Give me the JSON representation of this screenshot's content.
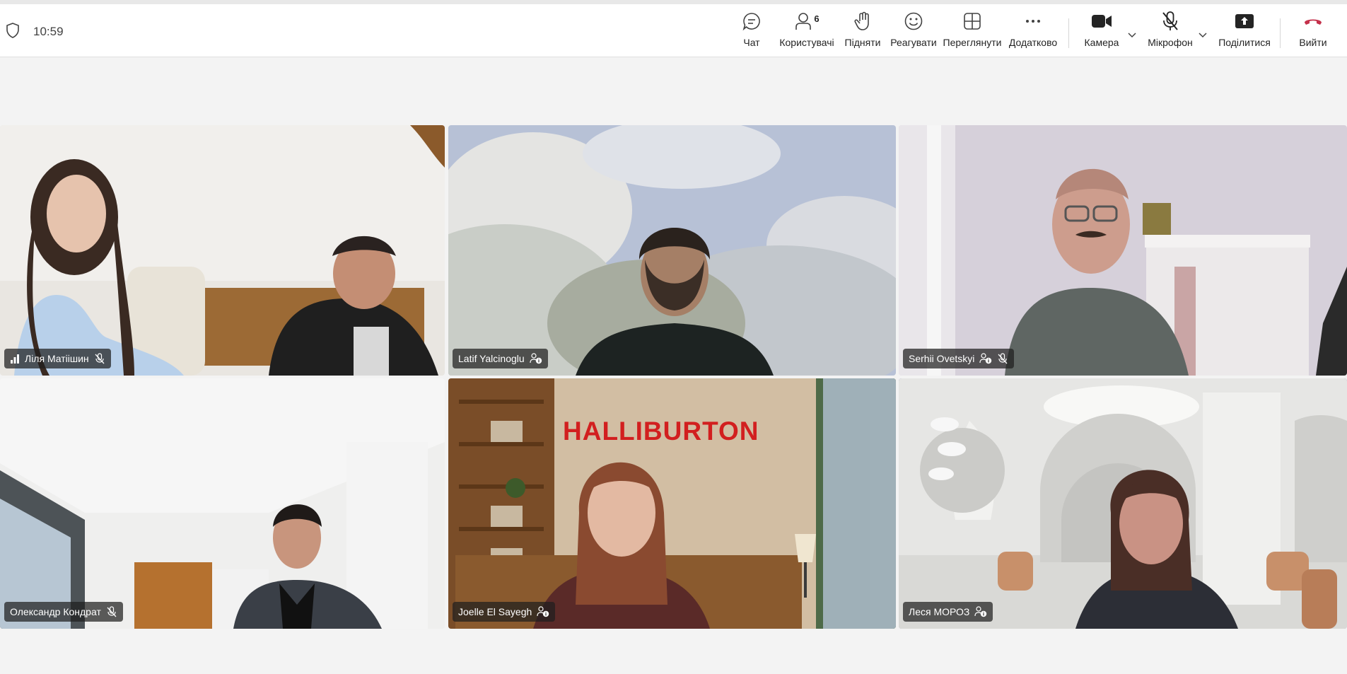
{
  "header": {
    "time": "10:59",
    "buttons": {
      "chat": "Чат",
      "people": "Користувачі",
      "people_count": "6",
      "raise": "Підняти",
      "react": "Реагувати",
      "view": "Переглянути",
      "more": "Додатково",
      "camera": "Камера",
      "mic": "Мікрофон",
      "share": "Поділитися",
      "leave": "Вийти"
    }
  },
  "participants": [
    {
      "name": "Ліля Матіішин",
      "muted": true,
      "signal_icon": true
    },
    {
      "name": "Latif Yalcinoglu",
      "muted": false
    },
    {
      "name": "Serhii Ovetskyi",
      "muted": true
    },
    {
      "name": "Олександр Кондрат",
      "muted": true
    },
    {
      "name": "Joelle El Sayegh",
      "muted": false
    },
    {
      "name": "Леся МОРОЗ",
      "muted": false,
      "active_speaker": true
    }
  ],
  "video_text": {
    "logo": "HALLIBURTON"
  },
  "colors": {
    "accent": "#6264a7",
    "leave": "#c4314b",
    "logo": "#d21f1f"
  }
}
